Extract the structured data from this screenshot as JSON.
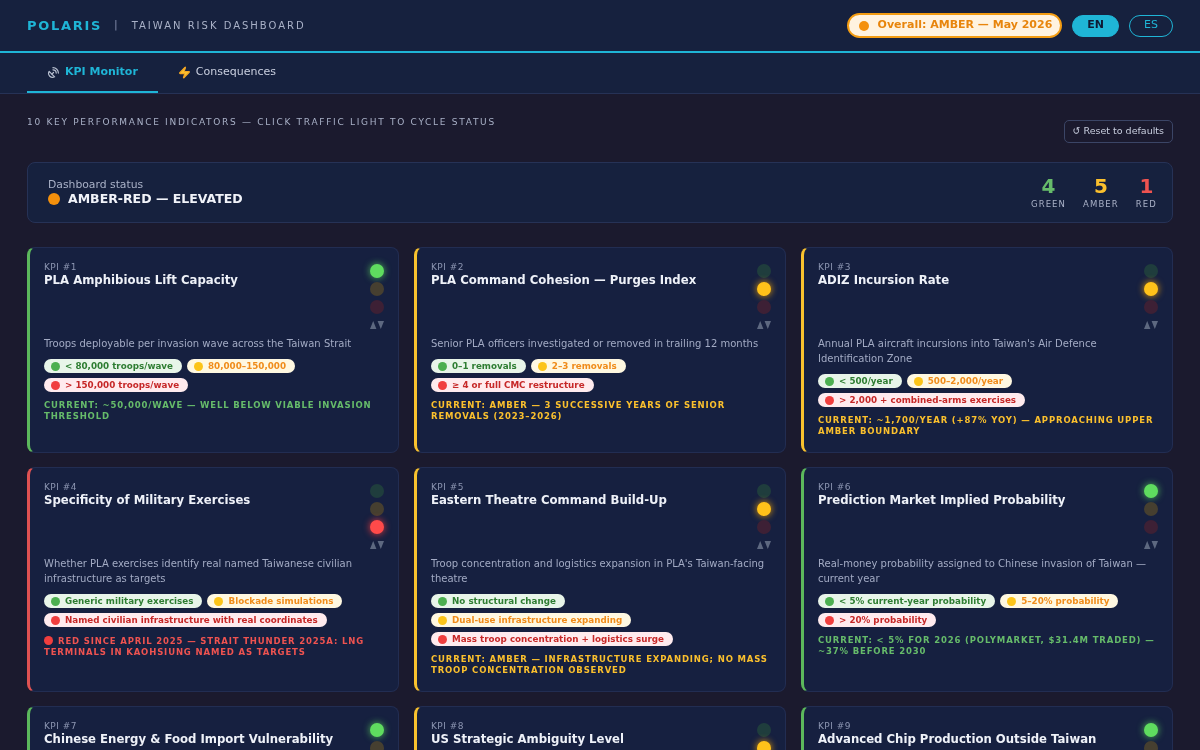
{
  "header": {
    "brand": "POLARIS",
    "separator": "|",
    "subtitle": "TAIWAN RISK DASHBOARD",
    "overall": "Overall: AMBER — May 2026",
    "languages": [
      {
        "label": "EN",
        "selected": true
      },
      {
        "label": "ES",
        "selected": false
      }
    ]
  },
  "tabs": [
    {
      "label": "KPI Monitor",
      "kind": "satellite",
      "selected": true
    },
    {
      "label": "Consequences",
      "kind": "lightning",
      "selected": false
    }
  ],
  "section": {
    "heading": "10 KEY PERFORMANCE INDICATORS — CLICK TRAFFIC LIGHT TO CYCLE STATUS",
    "reset_button": "↺ Reset to defaults"
  },
  "dashboard_status": {
    "label": "Dashboard status",
    "value": "AMBER-RED — ELEVATED",
    "counts": [
      {
        "value": "4",
        "label": "GREEN",
        "kind": "green"
      },
      {
        "value": "5",
        "label": "AMBER",
        "kind": "amber"
      },
      {
        "value": "1",
        "label": "RED",
        "kind": "red"
      }
    ]
  },
  "kpis": [
    {
      "number": "KPI #1",
      "title": "PLA Amphibious Lift Capacity",
      "kind": "green",
      "description": "Troops deployable per invasion wave across the Taiwan Strait",
      "thresholds": [
        {
          "kind": "green",
          "label": "< 80,000 troops/wave"
        },
        {
          "kind": "amber",
          "label": "80,000–150,000"
        },
        {
          "kind": "red",
          "label": "> 150,000 troops/wave"
        }
      ],
      "current": {
        "text": "CURRENT: ~50,000/WAVE — WELL BELOW VIABLE INVASION THRESHOLD"
      }
    },
    {
      "number": "KPI #2",
      "title": "PLA Command Cohesion — Purges Index",
      "kind": "amber",
      "description": "Senior PLA officers investigated or removed in trailing 12 months",
      "thresholds": [
        {
          "kind": "green",
          "label": "0–1 removals"
        },
        {
          "kind": "amber",
          "label": "2–3 removals"
        },
        {
          "kind": "red",
          "label": "≥ 4 or full CMC restructure"
        }
      ],
      "current": {
        "text": "CURRENT: AMBER — 3 SUCCESSIVE YEARS OF SENIOR REMOVALS (2023–2026)"
      }
    },
    {
      "number": "KPI #3",
      "title": "ADIZ Incursion Rate",
      "kind": "amber",
      "description": "Annual PLA aircraft incursions into Taiwan's Air Defence Identification Zone",
      "thresholds": [
        {
          "kind": "green",
          "label": "< 500/year"
        },
        {
          "kind": "amber",
          "label": "500–2,000/year"
        },
        {
          "kind": "red",
          "label": "> 2,000 + combined-arms exercises"
        }
      ],
      "current": {
        "text": "CURRENT: ~1,700/YEAR (+87% YOY) — APPROACHING UPPER AMBER BOUNDARY"
      }
    },
    {
      "number": "KPI #4",
      "title": "Specificity of Military Exercises",
      "kind": "red",
      "description": "Whether PLA exercises identify real named Taiwanese civilian infrastructure as targets",
      "thresholds": [
        {
          "kind": "green",
          "label": "Generic military exercises"
        },
        {
          "kind": "amber",
          "label": "Blockade simulations"
        },
        {
          "kind": "red",
          "label": "Named civilian infrastructure with real coordinates"
        }
      ],
      "current": {
        "text": "RED SINCE APRIL 2025 — STRAIT THUNDER 2025A: LNG TERMINALS IN KAOHSIUNG NAMED AS TARGETS",
        "dot": true
      }
    },
    {
      "number": "KPI #5",
      "title": "Eastern Theatre Command Build-Up",
      "kind": "amber",
      "description": "Troop concentration and logistics expansion in PLA's Taiwan-facing theatre",
      "thresholds": [
        {
          "kind": "green",
          "label": "No structural change"
        },
        {
          "kind": "amber",
          "label": "Dual-use infrastructure expanding"
        },
        {
          "kind": "red",
          "label": "Mass troop concentration + logistics surge"
        }
      ],
      "current": {
        "text": "CURRENT: AMBER — INFRASTRUCTURE EXPANDING; NO MASS TROOP CONCENTRATION OBSERVED"
      }
    },
    {
      "number": "KPI #6",
      "title": "Prediction Market Implied Probability",
      "kind": "green",
      "description": "Real-money probability assigned to Chinese invasion of Taiwan — current year",
      "thresholds": [
        {
          "kind": "green",
          "label": "< 5% current-year probability"
        },
        {
          "kind": "amber",
          "label": "5–20% probability"
        },
        {
          "kind": "red",
          "label": "> 20% probability"
        }
      ],
      "current": {
        "text": "CURRENT: < 5% FOR 2026 (POLYMARKET, $31.4M TRADED) — ~37% BEFORE 2030"
      }
    },
    {
      "number": "KPI #7",
      "title": "Chinese Energy & Food Import Vulnerability",
      "kind": "green"
    },
    {
      "number": "KPI #8",
      "title": "US Strategic Ambiguity Level",
      "kind": "amber"
    },
    {
      "number": "KPI #9",
      "title": "Advanced Chip Production Outside Taiwan",
      "kind": "green"
    }
  ]
}
